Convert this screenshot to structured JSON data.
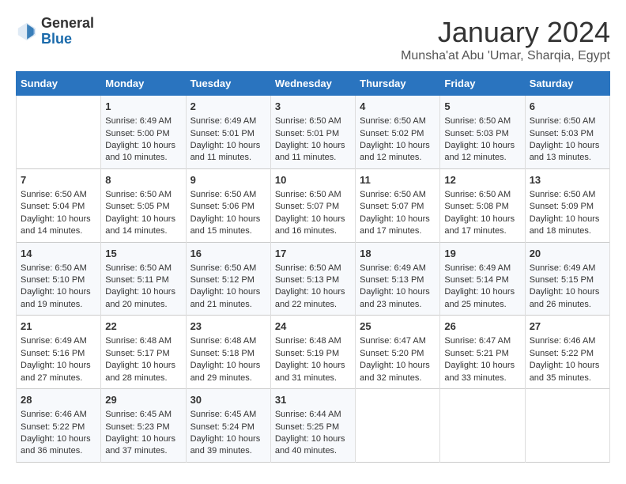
{
  "header": {
    "logo_general": "General",
    "logo_blue": "Blue",
    "month_title": "January 2024",
    "subtitle": "Munsha'at Abu 'Umar, Sharqia, Egypt"
  },
  "calendar": {
    "days_of_week": [
      "Sunday",
      "Monday",
      "Tuesday",
      "Wednesday",
      "Thursday",
      "Friday",
      "Saturday"
    ],
    "weeks": [
      [
        {
          "day": "",
          "content": ""
        },
        {
          "day": "1",
          "content": "Sunrise: 6:49 AM\nSunset: 5:00 PM\nDaylight: 10 hours\nand 10 minutes."
        },
        {
          "day": "2",
          "content": "Sunrise: 6:49 AM\nSunset: 5:01 PM\nDaylight: 10 hours\nand 11 minutes."
        },
        {
          "day": "3",
          "content": "Sunrise: 6:50 AM\nSunset: 5:01 PM\nDaylight: 10 hours\nand 11 minutes."
        },
        {
          "day": "4",
          "content": "Sunrise: 6:50 AM\nSunset: 5:02 PM\nDaylight: 10 hours\nand 12 minutes."
        },
        {
          "day": "5",
          "content": "Sunrise: 6:50 AM\nSunset: 5:03 PM\nDaylight: 10 hours\nand 12 minutes."
        },
        {
          "day": "6",
          "content": "Sunrise: 6:50 AM\nSunset: 5:03 PM\nDaylight: 10 hours\nand 13 minutes."
        }
      ],
      [
        {
          "day": "7",
          "content": "Sunrise: 6:50 AM\nSunset: 5:04 PM\nDaylight: 10 hours\nand 14 minutes."
        },
        {
          "day": "8",
          "content": "Sunrise: 6:50 AM\nSunset: 5:05 PM\nDaylight: 10 hours\nand 14 minutes."
        },
        {
          "day": "9",
          "content": "Sunrise: 6:50 AM\nSunset: 5:06 PM\nDaylight: 10 hours\nand 15 minutes."
        },
        {
          "day": "10",
          "content": "Sunrise: 6:50 AM\nSunset: 5:07 PM\nDaylight: 10 hours\nand 16 minutes."
        },
        {
          "day": "11",
          "content": "Sunrise: 6:50 AM\nSunset: 5:07 PM\nDaylight: 10 hours\nand 17 minutes."
        },
        {
          "day": "12",
          "content": "Sunrise: 6:50 AM\nSunset: 5:08 PM\nDaylight: 10 hours\nand 17 minutes."
        },
        {
          "day": "13",
          "content": "Sunrise: 6:50 AM\nSunset: 5:09 PM\nDaylight: 10 hours\nand 18 minutes."
        }
      ],
      [
        {
          "day": "14",
          "content": "Sunrise: 6:50 AM\nSunset: 5:10 PM\nDaylight: 10 hours\nand 19 minutes."
        },
        {
          "day": "15",
          "content": "Sunrise: 6:50 AM\nSunset: 5:11 PM\nDaylight: 10 hours\nand 20 minutes."
        },
        {
          "day": "16",
          "content": "Sunrise: 6:50 AM\nSunset: 5:12 PM\nDaylight: 10 hours\nand 21 minutes."
        },
        {
          "day": "17",
          "content": "Sunrise: 6:50 AM\nSunset: 5:13 PM\nDaylight: 10 hours\nand 22 minutes."
        },
        {
          "day": "18",
          "content": "Sunrise: 6:49 AM\nSunset: 5:13 PM\nDaylight: 10 hours\nand 23 minutes."
        },
        {
          "day": "19",
          "content": "Sunrise: 6:49 AM\nSunset: 5:14 PM\nDaylight: 10 hours\nand 25 minutes."
        },
        {
          "day": "20",
          "content": "Sunrise: 6:49 AM\nSunset: 5:15 PM\nDaylight: 10 hours\nand 26 minutes."
        }
      ],
      [
        {
          "day": "21",
          "content": "Sunrise: 6:49 AM\nSunset: 5:16 PM\nDaylight: 10 hours\nand 27 minutes."
        },
        {
          "day": "22",
          "content": "Sunrise: 6:48 AM\nSunset: 5:17 PM\nDaylight: 10 hours\nand 28 minutes."
        },
        {
          "day": "23",
          "content": "Sunrise: 6:48 AM\nSunset: 5:18 PM\nDaylight: 10 hours\nand 29 minutes."
        },
        {
          "day": "24",
          "content": "Sunrise: 6:48 AM\nSunset: 5:19 PM\nDaylight: 10 hours\nand 31 minutes."
        },
        {
          "day": "25",
          "content": "Sunrise: 6:47 AM\nSunset: 5:20 PM\nDaylight: 10 hours\nand 32 minutes."
        },
        {
          "day": "26",
          "content": "Sunrise: 6:47 AM\nSunset: 5:21 PM\nDaylight: 10 hours\nand 33 minutes."
        },
        {
          "day": "27",
          "content": "Sunrise: 6:46 AM\nSunset: 5:22 PM\nDaylight: 10 hours\nand 35 minutes."
        }
      ],
      [
        {
          "day": "28",
          "content": "Sunrise: 6:46 AM\nSunset: 5:22 PM\nDaylight: 10 hours\nand 36 minutes."
        },
        {
          "day": "29",
          "content": "Sunrise: 6:45 AM\nSunset: 5:23 PM\nDaylight: 10 hours\nand 37 minutes."
        },
        {
          "day": "30",
          "content": "Sunrise: 6:45 AM\nSunset: 5:24 PM\nDaylight: 10 hours\nand 39 minutes."
        },
        {
          "day": "31",
          "content": "Sunrise: 6:44 AM\nSunset: 5:25 PM\nDaylight: 10 hours\nand 40 minutes."
        },
        {
          "day": "",
          "content": ""
        },
        {
          "day": "",
          "content": ""
        },
        {
          "day": "",
          "content": ""
        }
      ]
    ]
  }
}
